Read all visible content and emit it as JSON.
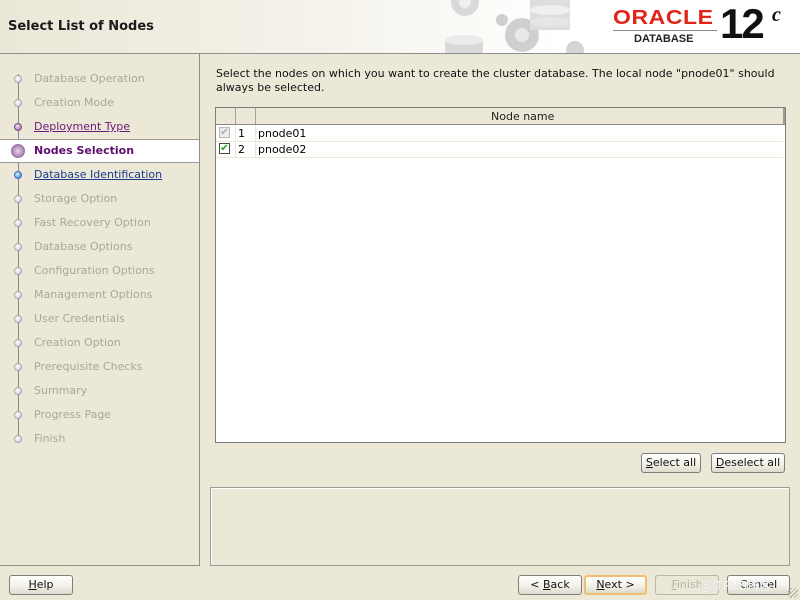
{
  "header": {
    "title": "Select List of Nodes",
    "logo": {
      "brand": "ORACLE",
      "product": "DATABASE",
      "version": "12",
      "version_suffix": "c",
      "brand_color": "#e2231a"
    }
  },
  "sidebar": {
    "steps": [
      {
        "label": "Database Operation",
        "state": "done"
      },
      {
        "label": "Creation Mode",
        "state": "done"
      },
      {
        "label": "Deployment Type",
        "state": "visited"
      },
      {
        "label": "Nodes Selection",
        "state": "current"
      },
      {
        "label": "Database Identification",
        "state": "next"
      },
      {
        "label": "Storage Option",
        "state": "pending"
      },
      {
        "label": "Fast Recovery Option",
        "state": "pending"
      },
      {
        "label": "Database Options",
        "state": "pending"
      },
      {
        "label": "Configuration Options",
        "state": "pending"
      },
      {
        "label": "Management Options",
        "state": "pending"
      },
      {
        "label": "User Credentials",
        "state": "pending"
      },
      {
        "label": "Creation Option",
        "state": "pending"
      },
      {
        "label": "Prerequisite Checks",
        "state": "pending"
      },
      {
        "label": "Summary",
        "state": "pending"
      },
      {
        "label": "Progress Page",
        "state": "pending"
      },
      {
        "label": "Finish",
        "state": "pending"
      }
    ]
  },
  "main": {
    "instruction": "Select the nodes on which you want to create the cluster database. The local node \"pnode01\" should always be selected.",
    "table": {
      "columns": [
        "",
        "",
        "Node name"
      ],
      "rows": [
        {
          "checked": true,
          "editable": false,
          "index": "1",
          "node_name": "pnode01"
        },
        {
          "checked": true,
          "editable": true,
          "index": "2",
          "node_name": "pnode02"
        }
      ]
    },
    "select_all": {
      "label_mnemonic": "S",
      "label_rest": "elect all"
    },
    "deselect_all": {
      "label_mnemonic": "D",
      "label_rest": "eselect all"
    },
    "message": ""
  },
  "footer": {
    "help": {
      "mnemonic": "H",
      "rest": "elp"
    },
    "back": {
      "prefix": "< ",
      "mnemonic": "B",
      "rest": "ack"
    },
    "next": {
      "mnemonic": "N",
      "rest": "ext >"
    },
    "finish": {
      "mnemonic": "F",
      "rest": "inish",
      "enabled": false
    },
    "cancel": {
      "label": "Cancel"
    }
  },
  "watermark": "@ITPUB博客"
}
